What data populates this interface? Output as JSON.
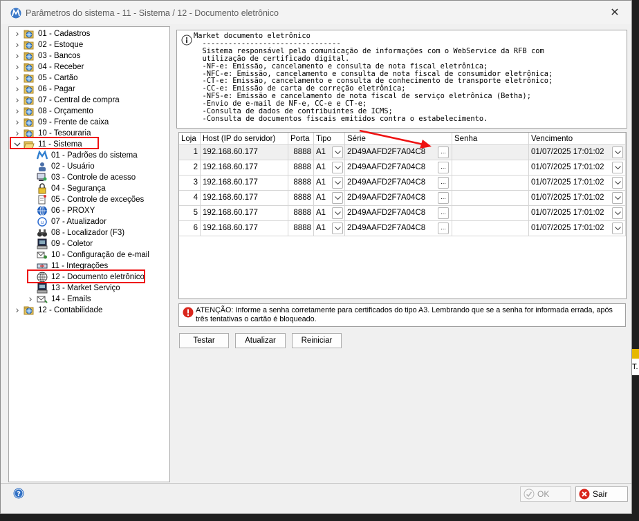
{
  "window": {
    "title": "Parâmetros do sistema - 11 - Sistema / 12 - Documento eletrônico",
    "close_icon": "close-icon"
  },
  "tree": [
    {
      "label": "01 - Cadastros",
      "level": 0,
      "expander": "collapsed",
      "icon": "folder-globe-icon"
    },
    {
      "label": "02 - Estoque",
      "level": 0,
      "expander": "collapsed",
      "icon": "folder-globe-icon"
    },
    {
      "label": "03 - Bancos",
      "level": 0,
      "expander": "collapsed",
      "icon": "folder-globe-icon"
    },
    {
      "label": "04 - Receber",
      "level": 0,
      "expander": "collapsed",
      "icon": "folder-globe-icon"
    },
    {
      "label": "05 - Cartão",
      "level": 0,
      "expander": "collapsed",
      "icon": "folder-globe-icon"
    },
    {
      "label": "06 - Pagar",
      "level": 0,
      "expander": "collapsed",
      "icon": "folder-globe-icon"
    },
    {
      "label": "07 - Central de compra",
      "level": 0,
      "expander": "collapsed",
      "icon": "folder-globe-icon"
    },
    {
      "label": "08 - Orçamento",
      "level": 0,
      "expander": "collapsed",
      "icon": "folder-globe-icon"
    },
    {
      "label": "09 - Frente de caixa",
      "level": 0,
      "expander": "collapsed",
      "icon": "folder-globe-icon"
    },
    {
      "label": "10 - Tesouraria",
      "level": 0,
      "expander": "collapsed",
      "icon": "folder-globe-icon"
    },
    {
      "label": "11 - Sistema",
      "level": 0,
      "expander": "expanded",
      "icon": "folder-open-icon"
    },
    {
      "label": "01 - Padrões do sistema",
      "level": 1,
      "expander": "none",
      "icon": "logo-m-icon"
    },
    {
      "label": "02 - Usuário",
      "level": 1,
      "expander": "none",
      "icon": "user-icon"
    },
    {
      "label": "03 - Controle de acesso",
      "level": 1,
      "expander": "none",
      "icon": "computer-user-icon"
    },
    {
      "label": "04 - Segurança",
      "level": 1,
      "expander": "none",
      "icon": "lock-icon"
    },
    {
      "label": "05 - Controle de exceções",
      "level": 1,
      "expander": "none",
      "icon": "document-pin-icon"
    },
    {
      "label": "06 - PROXY",
      "level": 1,
      "expander": "none",
      "icon": "globe-network-icon"
    },
    {
      "label": "07 - Atualizador",
      "level": 1,
      "expander": "none",
      "icon": "update-icon"
    },
    {
      "label": "08 - Localizador (F3)",
      "level": 1,
      "expander": "none",
      "icon": "binoculars-icon"
    },
    {
      "label": "09 - Coletor",
      "level": 1,
      "expander": "none",
      "icon": "terminal-icon"
    },
    {
      "label": "10 - Configuração de e-mail",
      "level": 1,
      "expander": "none",
      "icon": "email-config-icon"
    },
    {
      "label": "11 - Integrações",
      "level": 1,
      "expander": "none",
      "icon": "integration-icon"
    },
    {
      "label": "12 - Documento eletrônico",
      "level": 1,
      "expander": "none",
      "icon": "globe-icon"
    },
    {
      "label": "13 - Market Serviço",
      "level": 1,
      "expander": "none",
      "icon": "computer-icon"
    },
    {
      "label": "14 - Emails",
      "level": 1,
      "expander": "collapsed",
      "icon": "email-icon"
    },
    {
      "label": "12 - Contabilidade",
      "level": 0,
      "expander": "collapsed",
      "icon": "folder-globe-icon"
    }
  ],
  "info": {
    "icon": "info-icon",
    "text": "Market documento eletrônico\n  --------------------------------\n  Sistema responsável pela comunicação de informações com o WebService da RFB com\n  utilização de certificado digital.\n  -NF-e: Emissão, cancelamento e consulta de nota fiscal eletrônica;\n  -NFC-e: Emissão, cancelamento e consulta de nota fiscal de consumidor eletrônica;\n  -CT-e: Emissão, cancelamento e consulta de conhecimento de transporte eletrônico;\n  -CC-e: Emissão de carta de correção eletrônica;\n  -NFS-e: Emissão e cancelamento de nota fiscal de serviço eletrônica (Betha);\n  -Envio de e-mail de NF-e, CC-e e CT-e;\n  -Consulta de dados de contribuintes de ICMS;\n  -Consulta de documentos fiscais emitidos contra o estabelecimento."
  },
  "grid": {
    "columns": [
      "Loja",
      "Host (IP do servidor)",
      "Porta",
      "Tipo",
      "Série",
      "Senha",
      "Vencimento"
    ],
    "rows": [
      {
        "loja": "1",
        "host": "192.168.60.177",
        "porta": "8888",
        "tipo": "A1",
        "serie": "2D49AAFD2F7A04C8",
        "senha": "",
        "vencimento": "01/07/2025 17:01:02"
      },
      {
        "loja": "2",
        "host": "192.168.60.177",
        "porta": "8888",
        "tipo": "A1",
        "serie": "2D49AAFD2F7A04C8",
        "senha": "",
        "vencimento": "01/07/2025 17:01:02"
      },
      {
        "loja": "3",
        "host": "192.168.60.177",
        "porta": "8888",
        "tipo": "A1",
        "serie": "2D49AAFD2F7A04C8",
        "senha": "",
        "vencimento": "01/07/2025 17:01:02"
      },
      {
        "loja": "4",
        "host": "192.168.60.177",
        "porta": "8888",
        "tipo": "A1",
        "serie": "2D49AAFD2F7A04C8",
        "senha": "",
        "vencimento": "01/07/2025 17:01:02"
      },
      {
        "loja": "5",
        "host": "192.168.60.177",
        "porta": "8888",
        "tipo": "A1",
        "serie": "2D49AAFD2F7A04C8",
        "senha": "",
        "vencimento": "01/07/2025 17:01:02"
      },
      {
        "loja": "6",
        "host": "192.168.60.177",
        "porta": "8888",
        "tipo": "A1",
        "serie": "2D49AAFD2F7A04C8",
        "senha": "",
        "vencimento": "01/07/2025 17:01:02"
      }
    ],
    "ellipsis": "..."
  },
  "alert": {
    "icon": "error-icon",
    "text": "ATENÇÃO: Informe a senha corretamente para certificados do tipo A3. Lembrando que se a senha for informada errada, após três tentativas o cartão é bloqueado."
  },
  "actions": {
    "test": "Testar",
    "update": "Atualizar",
    "restart": "Reiniciar"
  },
  "footer": {
    "ok": "OK",
    "exit": "Sair",
    "help_icon": "help-icon"
  },
  "behind_window_text": "T."
}
